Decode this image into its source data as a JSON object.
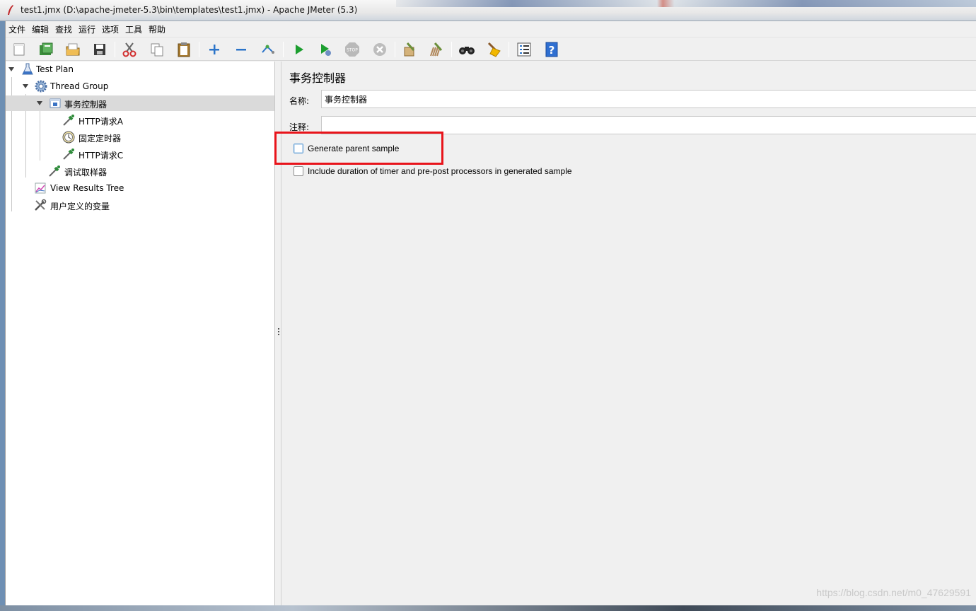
{
  "window": {
    "title": "test1.jmx (D:\\apache-jmeter-5.3\\bin\\templates\\test1.jmx) - Apache JMeter (5.3)"
  },
  "menubar": {
    "items": [
      "文件",
      "编辑",
      "查找",
      "运行",
      "选项",
      "工具",
      "帮助"
    ]
  },
  "toolbar": {
    "buttons": [
      "new-icon",
      "templates-icon",
      "open-icon",
      "save-icon",
      "cut-icon",
      "copy-icon",
      "paste-icon",
      "expand-icon",
      "collapse-icon",
      "toggle-icon",
      "start-icon",
      "start-no-pauses-icon",
      "stop-icon",
      "shutdown-icon",
      "clear-icon",
      "clear-all-icon",
      "search-icon",
      "reset-search-icon",
      "function-helper-icon",
      "help-icon"
    ]
  },
  "tree": {
    "items": [
      {
        "label": "Test Plan",
        "icon": "flask-icon",
        "expanded": true
      },
      {
        "label": "Thread Group",
        "icon": "gear-icon",
        "expanded": true
      },
      {
        "label": "事务控制器",
        "icon": "transaction-controller-icon",
        "expanded": true,
        "selected": true
      },
      {
        "label": "HTTP请求A",
        "icon": "pipette-icon"
      },
      {
        "label": "固定定时器",
        "icon": "timer-icon"
      },
      {
        "label": "HTTP请求C",
        "icon": "pipette-icon"
      },
      {
        "label": "调试取样器",
        "icon": "pipette-icon"
      },
      {
        "label": "View Results Tree",
        "icon": "chart-icon"
      },
      {
        "label": "用户定义的变量",
        "icon": "tools-icon"
      }
    ]
  },
  "panel": {
    "title": "事务控制器",
    "name_label": "名称:",
    "name_value": "事务控制器",
    "comment_label": "注释:",
    "comment_value": "",
    "generate_parent_sample": {
      "label": "Generate parent sample",
      "checked": false
    },
    "include_duration": {
      "label": "Include duration of timer and pre-post processors in generated sample",
      "checked": false
    }
  },
  "watermark": "https://blog.csdn.net/m0_47629591",
  "colors": {
    "highlight": "#e8141b",
    "selected_row": "#dadada"
  }
}
